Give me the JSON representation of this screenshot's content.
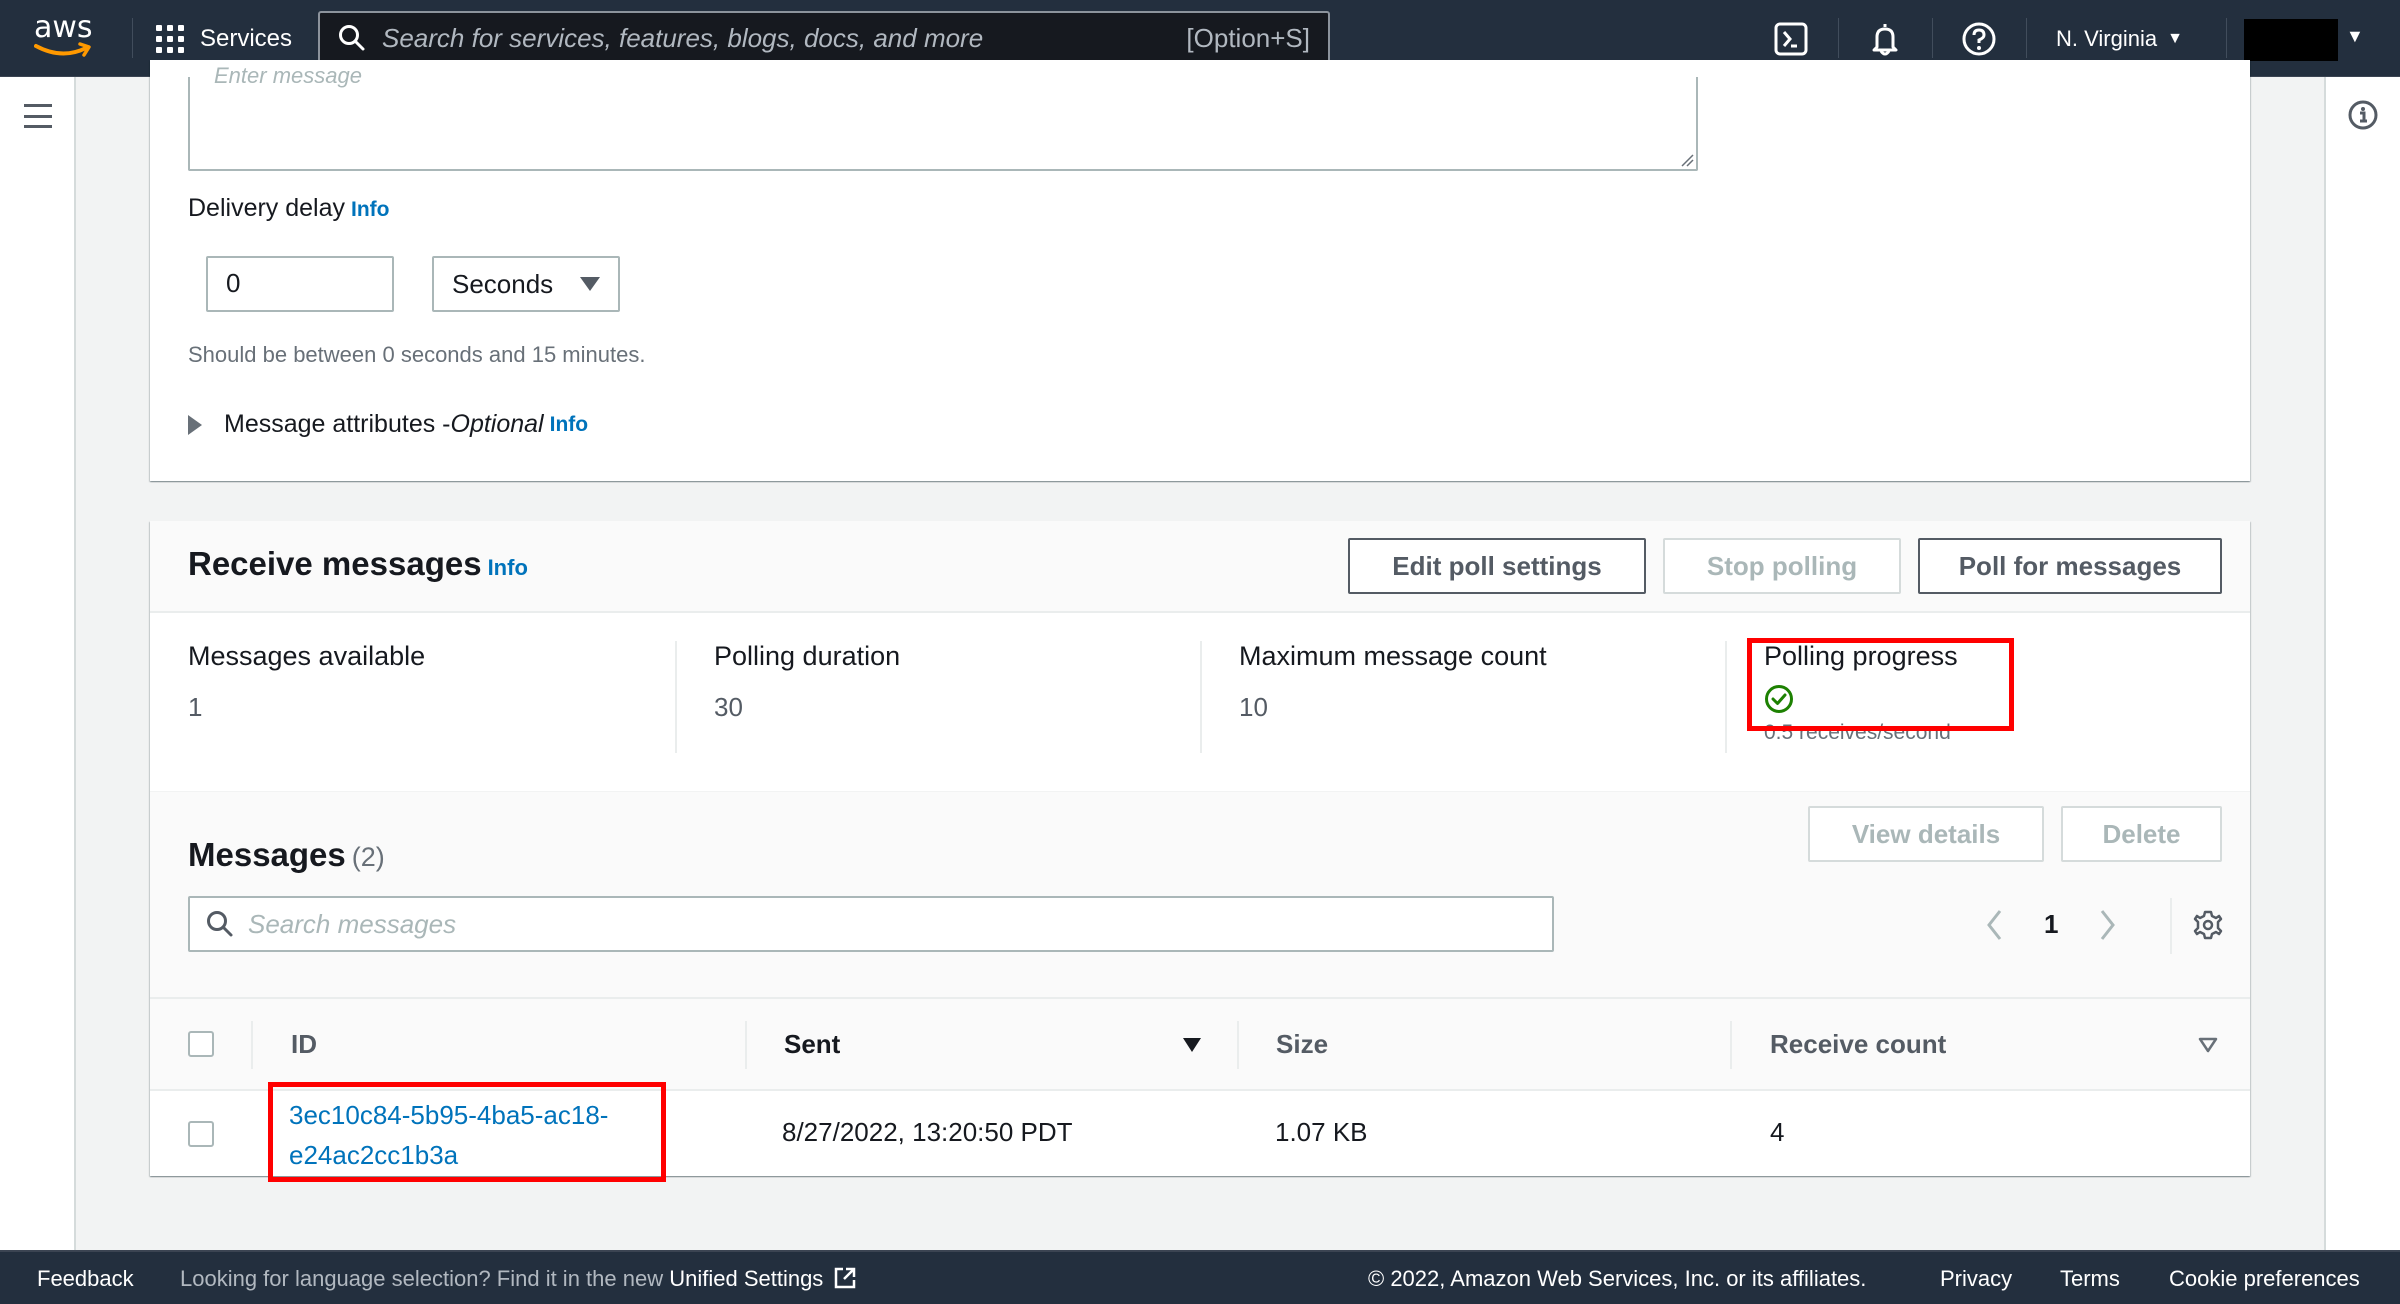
{
  "topnav": {
    "logo_text": "aws",
    "services_label": "Services",
    "search_placeholder": "Search for services, features, blogs, docs, and more",
    "search_shortcut": "[Option+S]",
    "region_label": "N. Virginia",
    "icons": [
      "cloudshell-icon",
      "bell-icon",
      "help-icon"
    ]
  },
  "send": {
    "message_placeholder": "Enter message",
    "delivery_delay_label": "Delivery delay",
    "info_label": "Info",
    "delay_value": "0",
    "delay_unit": "Seconds",
    "delay_hint": "Should be between 0 seconds and 15 minutes.",
    "attributes_label": "Message attributes - ",
    "attributes_optional": "Optional"
  },
  "receive": {
    "title": "Receive messages",
    "info_label": "Info",
    "buttons": {
      "edit_poll_settings": "Edit poll settings",
      "stop_polling": "Stop polling",
      "poll_for_messages": "Poll for messages"
    },
    "stats": [
      {
        "label": "Messages available",
        "value": "1"
      },
      {
        "label": "Polling duration",
        "value": "30"
      },
      {
        "label": "Maximum message count",
        "value": "10"
      },
      {
        "label": "Polling progress",
        "value": "0.5 receives/second",
        "status": "success"
      }
    ]
  },
  "messages": {
    "title": "Messages",
    "count": "(2)",
    "view_details": "View details",
    "delete": "Delete",
    "search_placeholder": "Search messages",
    "current_page": "1",
    "columns": [
      "ID",
      "Sent",
      "Size",
      "Receive count"
    ],
    "rows": [
      {
        "id_line1": "3ec10c84-5b95-4ba5-ac18-",
        "id_line2": "e24ac2cc1b3a",
        "sent": "8/27/2022, 13:20:50 PDT",
        "size": "1.07 KB",
        "receive_count": "4"
      }
    ]
  },
  "footer": {
    "feedback": "Feedback",
    "language_text": "Looking for language selection? Find it in the new ",
    "unified_settings": "Unified Settings",
    "copyright": "© 2022, Amazon Web Services, Inc. or its affiliates.",
    "privacy": "Privacy",
    "terms": "Terms",
    "cookie_preferences": "Cookie preferences"
  },
  "colors": {
    "nav_bg": "#232f3e",
    "link": "#0073bb",
    "success": "#1d8102",
    "highlight": "#ff0000"
  }
}
